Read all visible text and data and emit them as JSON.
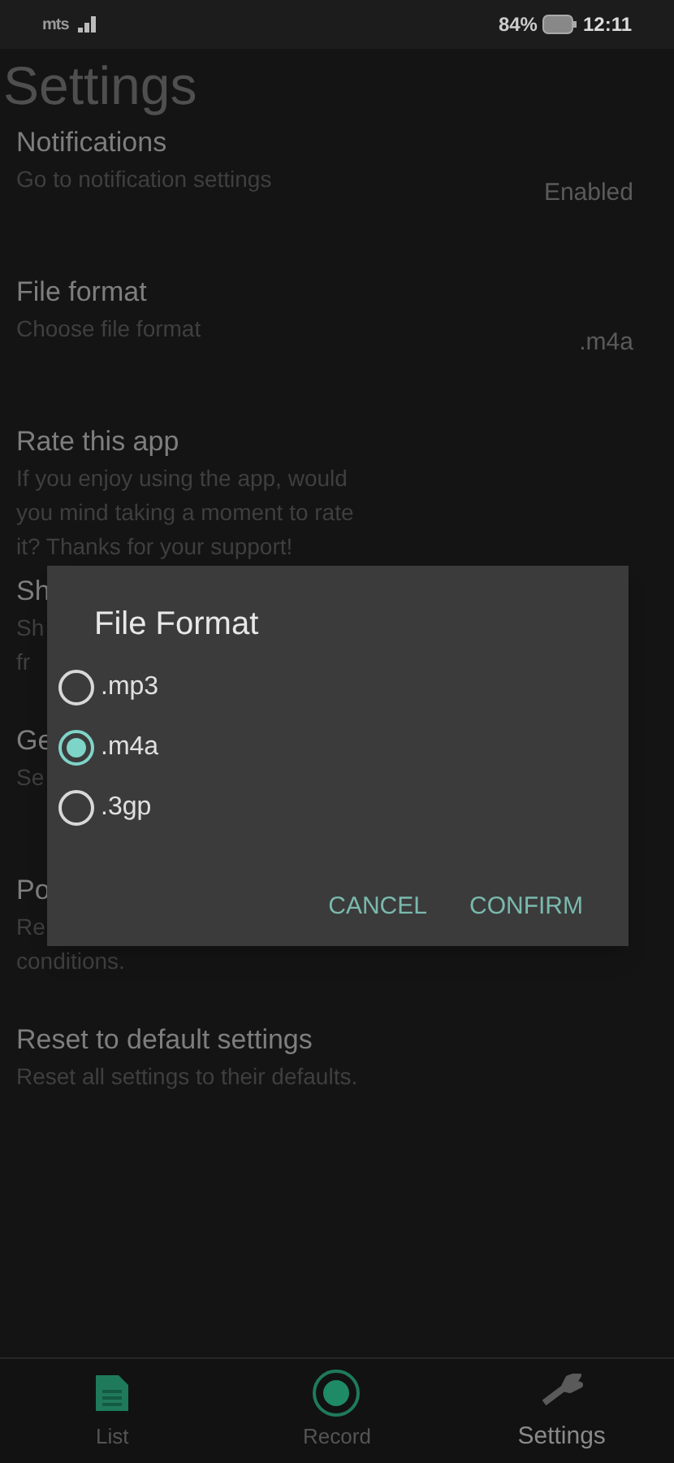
{
  "status_bar": {
    "carrier": "mts",
    "battery": "84%",
    "time": "12:11"
  },
  "title": "Settings",
  "settings": [
    {
      "title": "Notifications",
      "description": [
        "Go to notification settings"
      ],
      "value": "Enabled"
    },
    {
      "title": "File format",
      "description": [
        "Choose file format"
      ],
      "value": ".m4a"
    },
    {
      "title": "Rate this app",
      "description": [
        "If you enjoy using the app, would",
        "you mind taking a moment to rate",
        "it? Thanks for your support!"
      ]
    },
    {
      "title": "Sh",
      "description": [
        "Sh",
        "fr"
      ]
    },
    {
      "title": "Ge",
      "description": [
        "Se"
      ]
    },
    {
      "title": "Po",
      "description": [
        "Re",
        "conditions."
      ]
    },
    {
      "title": "Reset to default settings",
      "description": [
        "Reset all settings to their defaults."
      ]
    }
  ],
  "dialog": {
    "title": "File Format",
    "options": [
      {
        "label": ".mp3",
        "selected": false
      },
      {
        "label": ".m4a",
        "selected": true
      },
      {
        "label": ".3gp",
        "selected": false
      }
    ],
    "buttons": [
      "CANCEL",
      "CONFIRM"
    ]
  },
  "nav": [
    {
      "kind": "list",
      "label": "List",
      "selected": false
    },
    {
      "kind": "record",
      "label": "Record",
      "selected": false
    },
    {
      "kind": "settings",
      "label": "Settings",
      "selected": true
    }
  ]
}
